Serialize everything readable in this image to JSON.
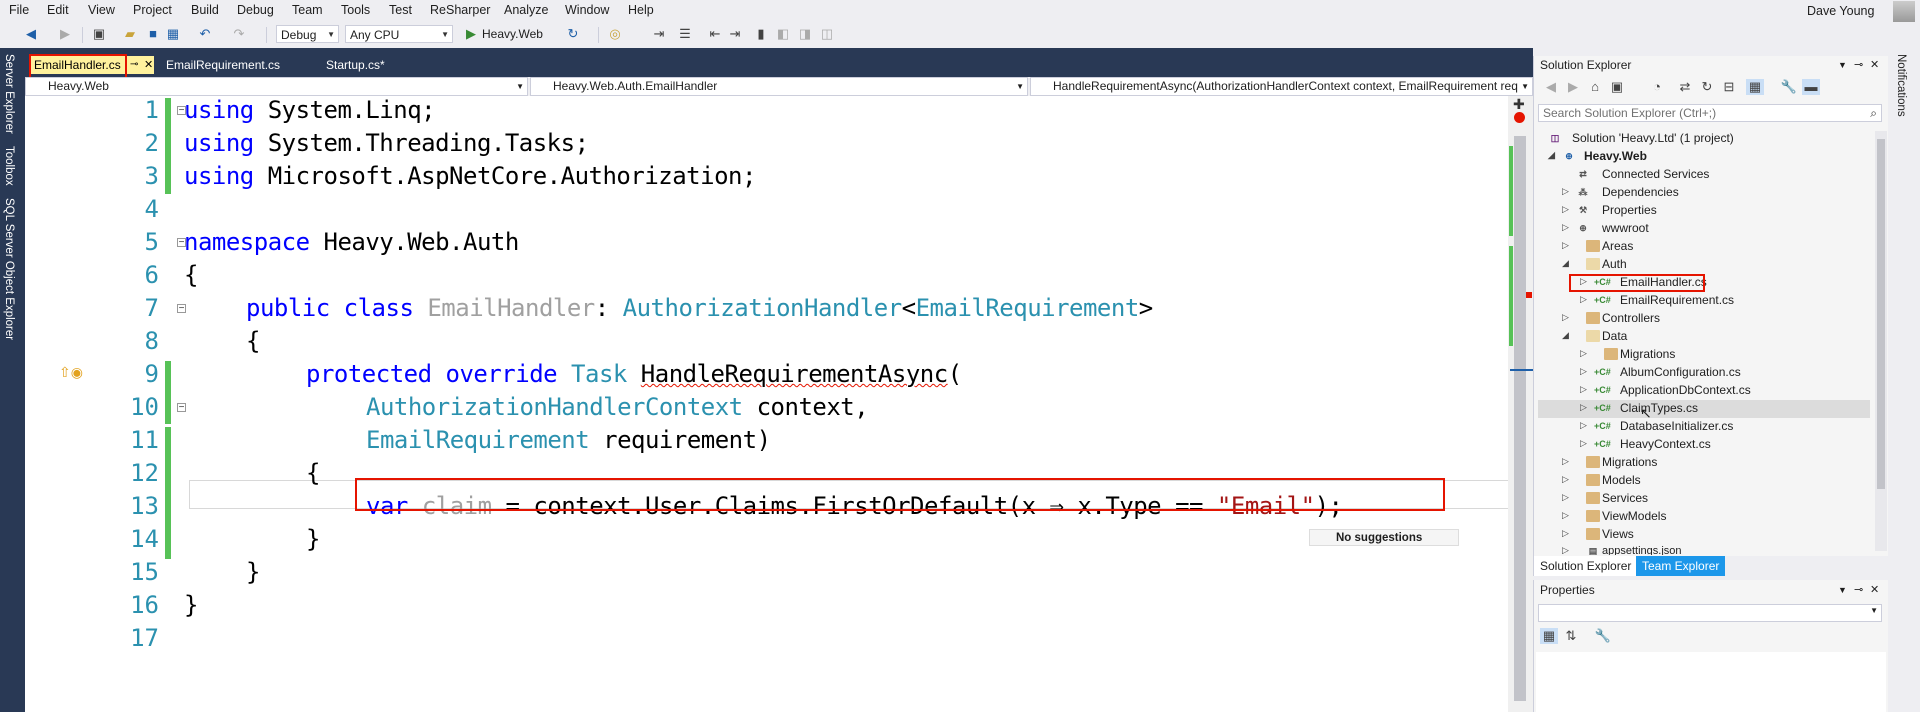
{
  "menu": {
    "items": [
      "File",
      "Edit",
      "View",
      "Project",
      "Build",
      "Debug",
      "Team",
      "Tools",
      "Test",
      "ReSharper",
      "Analyze",
      "Window",
      "Help"
    ],
    "user": "Dave Young"
  },
  "toolbar": {
    "config": "Debug",
    "platform": "Any CPU",
    "run_target": "Heavy.Web"
  },
  "left_strip": [
    "Server Explorer",
    "Toolbox",
    "SQL Server Object Explorer"
  ],
  "right_strip": "Notifications",
  "tabs": [
    "EmailHandler.cs",
    "EmailRequirement.cs",
    "Startup.cs*"
  ],
  "navbar": {
    "project": "Heavy.Web",
    "type": "Heavy.Web.Auth.EmailHandler",
    "member": "HandleRequirementAsync(AuthorizationHandlerContext context, EmailRequirement req"
  },
  "code": {
    "line_numbers": [
      "1",
      "2",
      "3",
      "4",
      "5",
      "6",
      "7",
      "8",
      "9",
      "10",
      "11",
      "12",
      "13",
      "14",
      "15",
      "16",
      "17"
    ],
    "l1_kw": "using",
    "l1_rest": " System.Linq;",
    "l2_kw": "using",
    "l2_rest": " System.Threading.Tasks;",
    "l3_kw": "using",
    "l3_rest": " Microsoft.AspNetCore.Authorization;",
    "l5_kw": "namespace",
    "l5_rest": " Heavy.Web.Auth",
    "l6": "{",
    "l7_kw1": "public",
    "l7_kw2": "class",
    "l7_name": "EmailHandler",
    "l7_colon": ": ",
    "l7_base": "AuthorizationHandler",
    "l7_lt": "<",
    "l7_arg": "EmailRequirement",
    "l7_gt": ">",
    "l8": "{",
    "l9_kw1": "protected",
    "l9_kw2": "override",
    "l9_type": "Task",
    "l9_method": "HandleRequirementAsync",
    "l9_paren": "(",
    "l10_type": "AuthorizationHandlerContext",
    "l10_rest": " context,",
    "l11_type": "EmailRequirement",
    "l11_rest": " requirement)",
    "l12": "{",
    "l13_kw": "var",
    "l13_var": "claim",
    "l13_mid": " = context.User.Claims.FirstOrDefault(x ⇒ x.Type == ",
    "l13_str": "\"Email\"",
    "l13_end": ");",
    "l14": "}",
    "l15": "}",
    "l16": "}"
  },
  "tooltip": "No suggestions",
  "solution_explorer": {
    "title": "Solution Explorer",
    "search_placeholder": "Search Solution Explorer (Ctrl+;)",
    "solution": "Solution 'Heavy.Ltd' (1 project)",
    "project": "Heavy.Web",
    "items": {
      "connected": "Connected Services",
      "dependencies": "Dependencies",
      "properties": "Properties",
      "wwwroot": "wwwroot",
      "areas": "Areas",
      "auth": "Auth",
      "emailhandler": "EmailHandler.cs",
      "emailrequirement": "EmailRequirement.cs",
      "controllers": "Controllers",
      "data": "Data",
      "migrations_inner": "Migrations",
      "albumconfig": "AlbumConfiguration.cs",
      "appdbcontext": "ApplicationDbContext.cs",
      "claimtypes": "ClaimTypes.cs",
      "dbinit": "DatabaseInitializer.cs",
      "heavycontext": "HeavyContext.cs",
      "migrations": "Migrations",
      "models": "Models",
      "services": "Services",
      "viewmodels": "ViewModels",
      "views": "Views",
      "appsettings": "appsettings.json"
    },
    "bottom_tabs": [
      "Solution Explorer",
      "Team Explorer"
    ]
  },
  "properties": {
    "title": "Properties"
  }
}
